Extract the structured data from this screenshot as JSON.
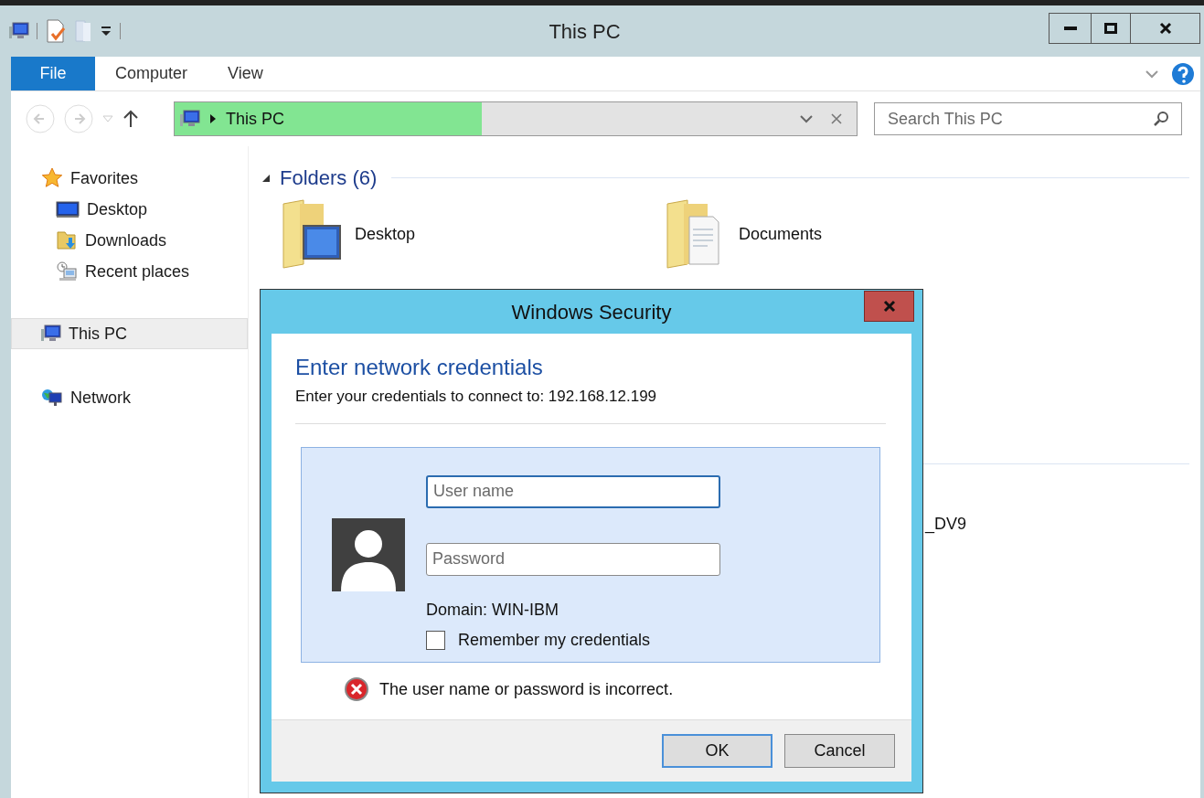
{
  "window": {
    "title": "This PC"
  },
  "ribbon_tabs": [
    {
      "label": "File",
      "selected": true
    },
    {
      "label": "Computer",
      "selected": false
    },
    {
      "label": "View",
      "selected": false
    }
  ],
  "address_bar": {
    "path": "This PC",
    "level": 0.45
  },
  "search": {
    "placeholder": "Search This PC"
  },
  "sidebar": {
    "items": [
      {
        "label": "Favorites",
        "kind": "star",
        "selected": false,
        "children": [
          {
            "label": "Desktop",
            "kind": "desktop",
            "selected": false
          },
          {
            "label": "Downloads",
            "kind": "downloads",
            "selected": false
          },
          {
            "label": "Recent places",
            "kind": "recent",
            "selected": false
          }
        ]
      },
      {
        "label": "This PC",
        "kind": "pc",
        "selected": true
      },
      {
        "label": "Network",
        "kind": "network",
        "selected": false
      }
    ]
  },
  "content": {
    "groups": [
      {
        "title": "Folders (6)",
        "expanded": true,
        "items": [
          {
            "label": "Desktop",
            "kind": "desktop"
          },
          {
            "label": "Documents",
            "kind": "documents"
          }
        ]
      }
    ],
    "partial_item": "_DV9"
  },
  "dialog": {
    "title": "Windows Security",
    "heading": "Enter network credentials",
    "subtitle": "Enter your credentials to connect to: 192.168.12.199",
    "username": {
      "placeholder": "User name",
      "focused": true
    },
    "password": {
      "placeholder": "Password",
      "focused": false
    },
    "domain": "Domain: WIN-IBM",
    "remember": {
      "label": "Remember my credentials",
      "checked": false
    },
    "error": "The user name or password is incorrect.",
    "buttons": [
      {
        "label": "OK",
        "kind": "default"
      },
      {
        "label": "Cancel",
        "kind": "normal"
      }
    ]
  }
}
